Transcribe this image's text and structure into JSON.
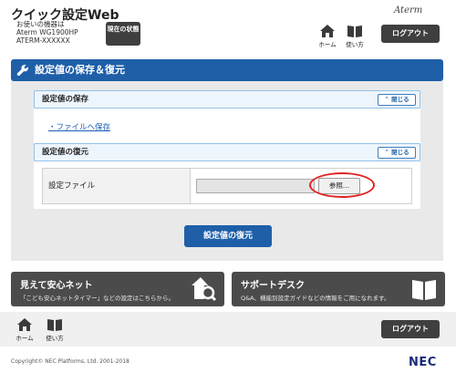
{
  "header": {
    "app_title": "クイック設定Web",
    "device_label": "お使いの機器は",
    "device_model": "Aterm WG1900HP",
    "device_id": "ATERM-XXXXXX",
    "status_button": "現在の状態",
    "home_label": "ホーム",
    "help_label": "使い方",
    "brand": "Aterm",
    "logout_label": "ログアウト"
  },
  "page": {
    "title": "設定値の保存＆復元"
  },
  "save_section": {
    "title": "設定値の保存",
    "close_label": "閉じる",
    "save_link": "ファイルへ保存"
  },
  "restore_section": {
    "title": "設定値の復元",
    "close_label": "閉じる",
    "file_label": "設定ファイル",
    "file_value": "",
    "browse_label": "参照...",
    "restore_button": "設定値の復元"
  },
  "banners": {
    "left_title": "見えて安心ネット",
    "left_desc": "「こども安心ネットタイマー」などの設定はこちらから。",
    "right_title": "サポートデスク",
    "right_desc": "Q&A、機能別設定ガイドなどの情報をご用になれます。"
  },
  "footer": {
    "home_label": "ホーム",
    "help_label": "使い方",
    "logout_label": "ログアウト",
    "copyright": "Copyright© NEC Platforms, Ltd. 2001-2018",
    "company_logo": "NEC"
  },
  "colors": {
    "accent_blue": "#1e5fa8",
    "dark_button": "#3f3f3f",
    "highlight_red": "#e12424"
  }
}
